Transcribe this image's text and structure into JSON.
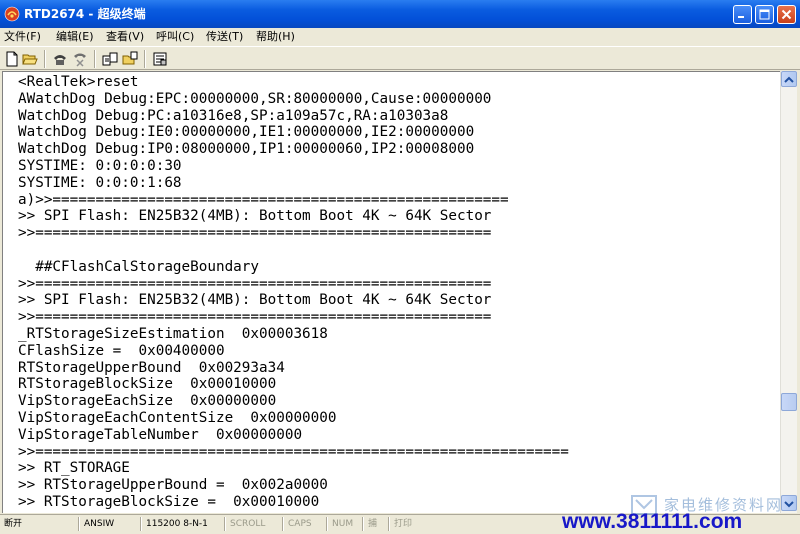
{
  "window": {
    "title": "RTD2674 - 超级终端"
  },
  "menu": {
    "items": [
      {
        "label": "文件(F)"
      },
      {
        "label": "编辑(E)"
      },
      {
        "label": "查看(V)"
      },
      {
        "label": "呼叫(C)"
      },
      {
        "label": "传送(T)"
      },
      {
        "label": "帮助(H)"
      }
    ]
  },
  "toolbar": {
    "icons": [
      "new-file-icon",
      "open-folder-icon",
      "call-icon",
      "disconnect-icon",
      "send-icon",
      "receive-icon",
      "properties-icon"
    ]
  },
  "terminal": {
    "lines": [
      "<RealTek>reset",
      "AWatchDog Debug:EPC:00000000,SR:80000000,Cause:00000000",
      "WatchDog Debug:PC:a10316e8,SP:a109a57c,RA:a10303a8",
      "WatchDog Debug:IE0:00000000,IE1:00000000,IE2:00000000",
      "WatchDog Debug:IP0:08000000,IP1:00000060,IP2:00008000",
      "SYSTIME: 0:0:0:0:30",
      "SYSTIME: 0:0:0:1:68",
      "a)>>=====================================================",
      ">> SPI Flash: EN25B32(4MB): Bottom Boot 4K ~ 64K Sector",
      ">>=====================================================",
      "",
      "  ##CFlashCalStorageBoundary",
      ">>=====================================================",
      ">> SPI Flash: EN25B32(4MB): Bottom Boot 4K ~ 64K Sector",
      ">>=====================================================",
      "_RTStorageSizeEstimation  0x00003618",
      "CFlashSize =  0x00400000",
      "RTStorageUpperBound  0x00293a34",
      "RTStorageBlockSize  0x00010000",
      "VipStorageEachSize  0x00000000",
      "VipStorageEachContentSize  0x00000000",
      "VipStorageTableNumber  0x00000000",
      ">>==============================================================",
      ">> RT_STORAGE",
      ">> RTStorageUpperBound =  0x002a0000",
      ">> RTStorageBlockSize =  0x00010000"
    ]
  },
  "status": {
    "connection": "断开",
    "emulation": "ANSIW",
    "port_settings": "115200 8-N-1",
    "scroll": "SCROLL",
    "caps": "CAPS",
    "num": "NUM",
    "capture": "捕",
    "print": "打印"
  },
  "watermark": {
    "logo": "家电维修资料网",
    "url": "www.3811111.com"
  },
  "colors": {
    "titlebar": "#0a5ce0",
    "watermark_url": "#1818c8"
  }
}
